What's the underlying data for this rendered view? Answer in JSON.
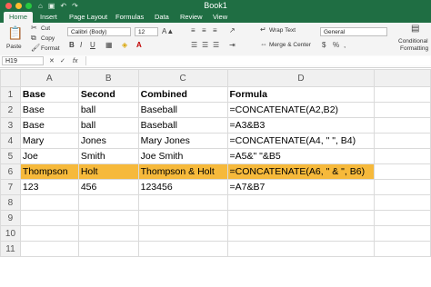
{
  "window": {
    "title": "Book1"
  },
  "tabs": [
    "Home",
    "Insert",
    "Page Layout",
    "Formulas",
    "Data",
    "Review",
    "View"
  ],
  "ribbon": {
    "paste": "Paste",
    "cut": "Cut",
    "copy": "Copy",
    "format": "Format",
    "font_name": "Calibri (Body)",
    "font_size": "12",
    "bold": "B",
    "italic": "I",
    "underline": "U",
    "wrap_text": "Wrap Text",
    "merge_center": "Merge & Center",
    "number_format": "General",
    "conditional": "Conditional",
    "formatting": "Formatting"
  },
  "formula_bar": {
    "name_box": "H19",
    "fx": "fx",
    "cancel": "✕",
    "enter": "✓"
  },
  "columns": [
    "A",
    "B",
    "C",
    "D"
  ],
  "rows": [
    {
      "num": "1",
      "cells": [
        "Base",
        "Second",
        "Combined",
        "Formula"
      ]
    },
    {
      "num": "2",
      "cells": [
        "Base",
        "ball",
        "Baseball",
        "=CONCATENATE(A2,B2)"
      ]
    },
    {
      "num": "3",
      "cells": [
        "Base",
        "ball",
        "Baseball",
        "=A3&B3"
      ]
    },
    {
      "num": "4",
      "cells": [
        "Mary",
        "Jones",
        "Mary Jones",
        "=CONCATENATE(A4, \" \", B4)"
      ]
    },
    {
      "num": "5",
      "cells": [
        "Joe",
        "Smith",
        "Joe Smith",
        "=A5&\" \"&B5"
      ]
    },
    {
      "num": "6",
      "cells": [
        "Thompson",
        "Holt",
        "Thompson & Holt",
        "=CONCATENATE(A6, \" & \", B6)"
      ]
    },
    {
      "num": "7",
      "cells": [
        "123",
        "456",
        "123456",
        "=A7&B7"
      ]
    },
    {
      "num": "8",
      "cells": [
        "",
        "",
        "",
        ""
      ]
    },
    {
      "num": "9",
      "cells": [
        "",
        "",
        "",
        ""
      ]
    },
    {
      "num": "10",
      "cells": [
        "",
        "",
        "",
        ""
      ]
    },
    {
      "num": "11",
      "cells": [
        "",
        "",
        "",
        ""
      ]
    }
  ],
  "highlight_color": "#f6b93b",
  "accent_color": "#1f6e43"
}
